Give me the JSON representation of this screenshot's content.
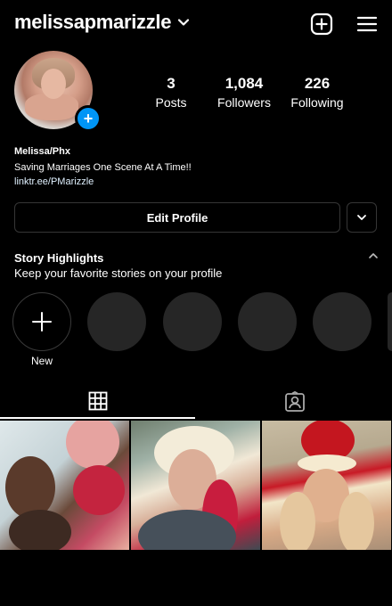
{
  "header": {
    "username": "melissapmarizzle"
  },
  "stats": [
    {
      "value": "3",
      "label": "Posts"
    },
    {
      "value": "1,084",
      "label": "Followers"
    },
    {
      "value": "226",
      "label": "Following"
    }
  ],
  "bio": {
    "name": "Melissa/Phx",
    "text": "Saving Marriages One Scene At A Time!!",
    "link": "linktr.ee/PMarizzle"
  },
  "actions": {
    "edit_profile": "Edit Profile"
  },
  "highlights": {
    "title": "Story Highlights",
    "subtitle": "Keep your favorite stories on your profile",
    "new_label": "New",
    "placeholder_count": 5
  },
  "colors": {
    "background": "#000000",
    "accent": "#0095f6",
    "button_border": "#363636",
    "highlight_fill": "#262626"
  }
}
